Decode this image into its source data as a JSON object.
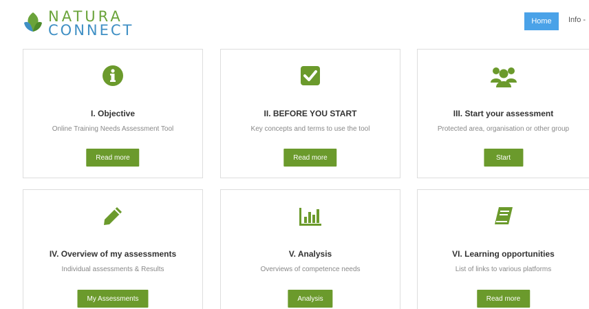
{
  "brand": {
    "line1": "NATURA",
    "line2": "CONNECT",
    "green": "#6aa33a",
    "blue": "#3f8fc4"
  },
  "nav": {
    "home": "Home",
    "info": "Info -"
  },
  "accent": "#6b9a2c",
  "cards": [
    {
      "icon": "info-circle-icon",
      "title": "I. Objective",
      "desc": "Online Training Needs Assessment Tool",
      "button": "Read more"
    },
    {
      "icon": "check-square-icon",
      "title": "II. BEFORE YOU START",
      "desc": "Key concepts and terms to use the tool",
      "button": "Read more"
    },
    {
      "icon": "users-icon",
      "title": "III. Start your assessment",
      "desc": "Protected area, organisation or other group",
      "button": "Start"
    },
    {
      "icon": "pencil-icon",
      "title": "IV. Overview of my assessments",
      "desc": "Individual assessments & Results",
      "button": "My Assessments"
    },
    {
      "icon": "bar-chart-icon",
      "title": "V. Analysis",
      "desc": "Overviews of competence needs",
      "button": "Analysis"
    },
    {
      "icon": "book-icon",
      "title": "VI. Learning opportunities",
      "desc": "List of links to various platforms",
      "button": "Read more"
    }
  ]
}
